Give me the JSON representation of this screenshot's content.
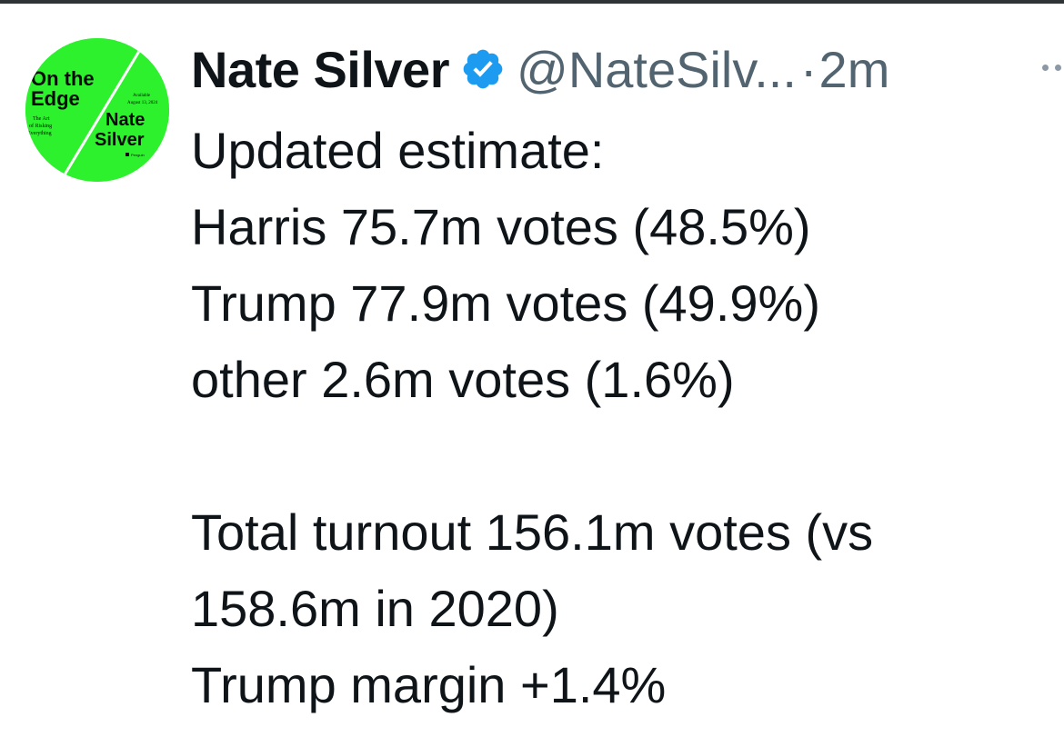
{
  "avatar": {
    "book_title_line1": "On the",
    "book_title_line2": "Edge",
    "subtitle_lines": [
      "The Art",
      "of Risking",
      "Everything"
    ],
    "author_line1": "Nate",
    "author_line2": "Silver",
    "available_line1": "Available",
    "available_line2": "August 13, 2024",
    "publisher": "Penguin",
    "bg_color": "#2ef12e"
  },
  "tweet": {
    "display_name": "Nate Silver",
    "verified_icon": "verified-badge-icon",
    "verified_color": "#1d9bf0",
    "handle": "@NateSilv...",
    "separator": "·",
    "time": "2m",
    "more_icon": "more-dots-icon",
    "lines": [
      "Updated estimate:",
      "Harris 75.7m votes (48.5%)",
      "Trump 77.9m votes (49.9%)",
      "other 2.6m votes (1.6%)",
      "",
      "Total turnout 156.1m votes (vs",
      "158.6m in 2020)",
      "Trump margin +1.4%"
    ]
  }
}
